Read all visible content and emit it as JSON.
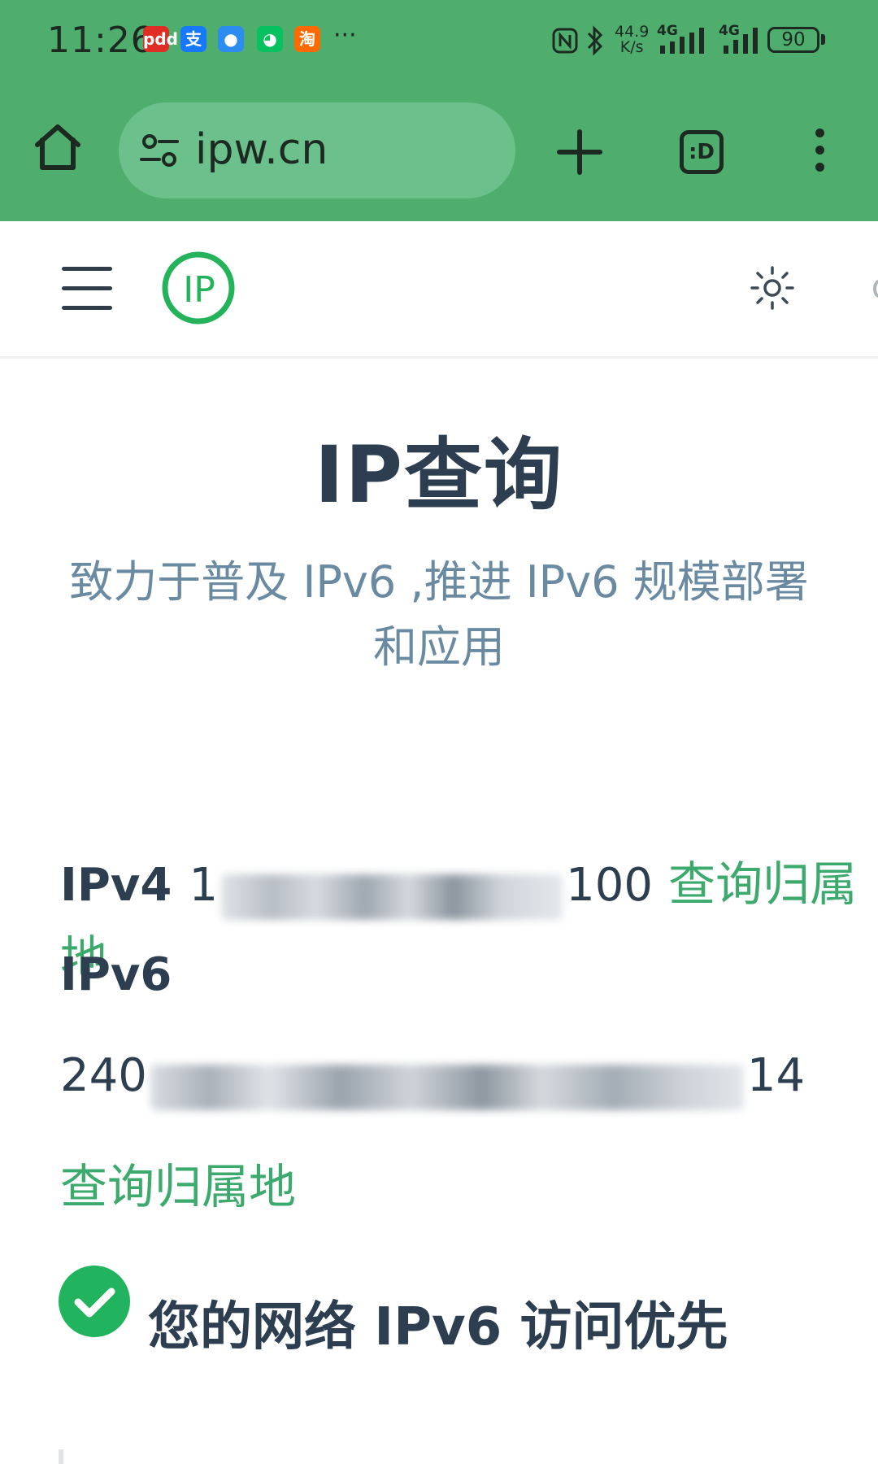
{
  "status_bar": {
    "time": "11:26",
    "notification_icons": [
      {
        "name": "pinduoduo-icon",
        "glyph": "pdd",
        "color": "#e02e24"
      },
      {
        "name": "alipay-icon",
        "glyph": "支",
        "color": "#1677ff"
      },
      {
        "name": "message-icon",
        "glyph": "●",
        "color": "#2d8cf0"
      },
      {
        "name": "wechat-icon",
        "glyph": "◕",
        "color": "#07c160"
      },
      {
        "name": "taobao-icon",
        "glyph": "淘",
        "color": "#ff6a00"
      }
    ],
    "more_notifications": "···",
    "network_speed_value": "44.9",
    "network_speed_unit": "K/s",
    "signal_1_label": "4G",
    "signal_2_label": "4G",
    "battery": "90"
  },
  "browser": {
    "url": "ipw.cn",
    "tab_switcher_label": ":D"
  },
  "page": {
    "title": "IP查询",
    "tagline": "致力于普及 IPv6 ,推进 IPv6 规模部署和应用",
    "ipv4": {
      "label": "IPv4",
      "value_prefix": "1",
      "value_suffix": "100",
      "lookup_link": "查询归属地"
    },
    "ipv6": {
      "label": "IPv6",
      "value_prefix": "240",
      "value_suffix": "14",
      "lookup_link": "查询归属地"
    },
    "status_message": "您的网络 IPv6 访问优先"
  },
  "colors": {
    "chrome_green": "#4fae6e",
    "link_green": "#3daa6d",
    "heading": "#2c3e50",
    "tagline": "#6a8aa2"
  }
}
